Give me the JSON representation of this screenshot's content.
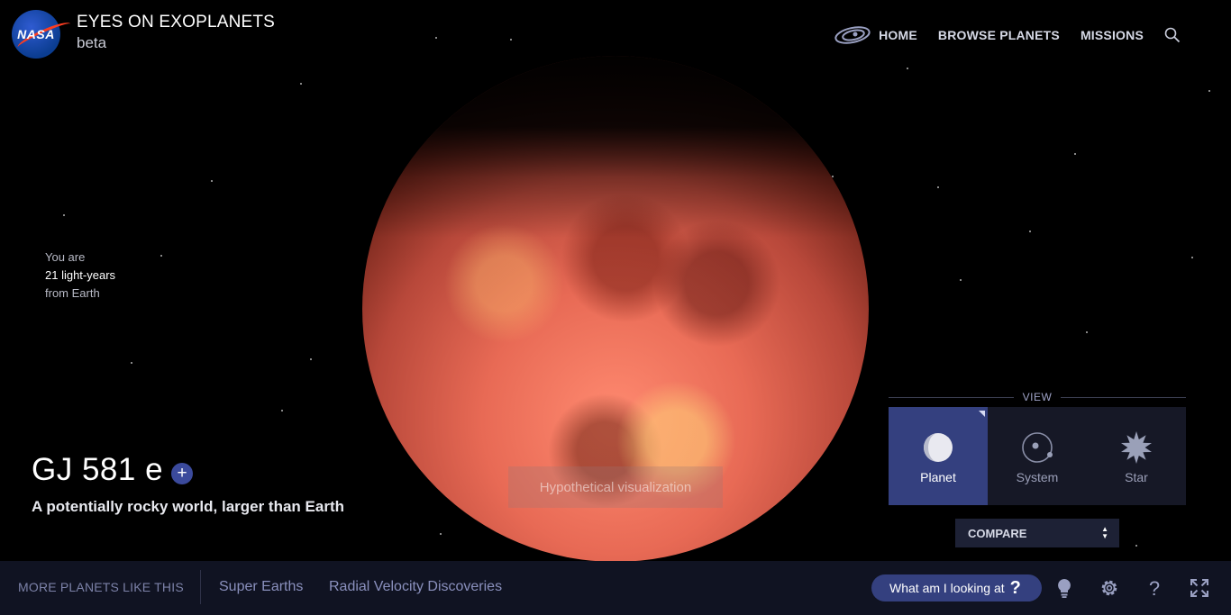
{
  "header": {
    "logo_text": "NASA",
    "title": "EYES ON EXOPLANETS",
    "subtitle": "beta",
    "nav": {
      "home": "HOME",
      "browse": "BROWSE PLANETS",
      "missions": "MISSIONS"
    }
  },
  "distance": {
    "line1": "You are",
    "line2": "21 light-years",
    "line3": "from Earth"
  },
  "planet": {
    "name": "GJ 581 e",
    "plus": "+",
    "description": "A potentially rocky world, larger than Earth"
  },
  "overlay": {
    "hypothetical": "Hypothetical visualization"
  },
  "view": {
    "label": "VIEW",
    "options": [
      {
        "label": "Planet",
        "icon": "planet-icon",
        "active": true
      },
      {
        "label": "System",
        "icon": "system-icon",
        "active": false
      },
      {
        "label": "Star",
        "icon": "star-icon",
        "active": false
      }
    ]
  },
  "compare": {
    "label": "COMPARE"
  },
  "bottom": {
    "more_label": "MORE PLANETS LIKE THIS",
    "categories": [
      "Super Earths",
      "Radial Velocity Discoveries"
    ],
    "looking_label": "What am I looking at",
    "looking_q": "?"
  },
  "colors": {
    "accent": "#34407f",
    "bar": "#101322",
    "panel": "#161826",
    "nasa_blue": "#0b3d91",
    "nasa_red": "#fc3d21"
  }
}
